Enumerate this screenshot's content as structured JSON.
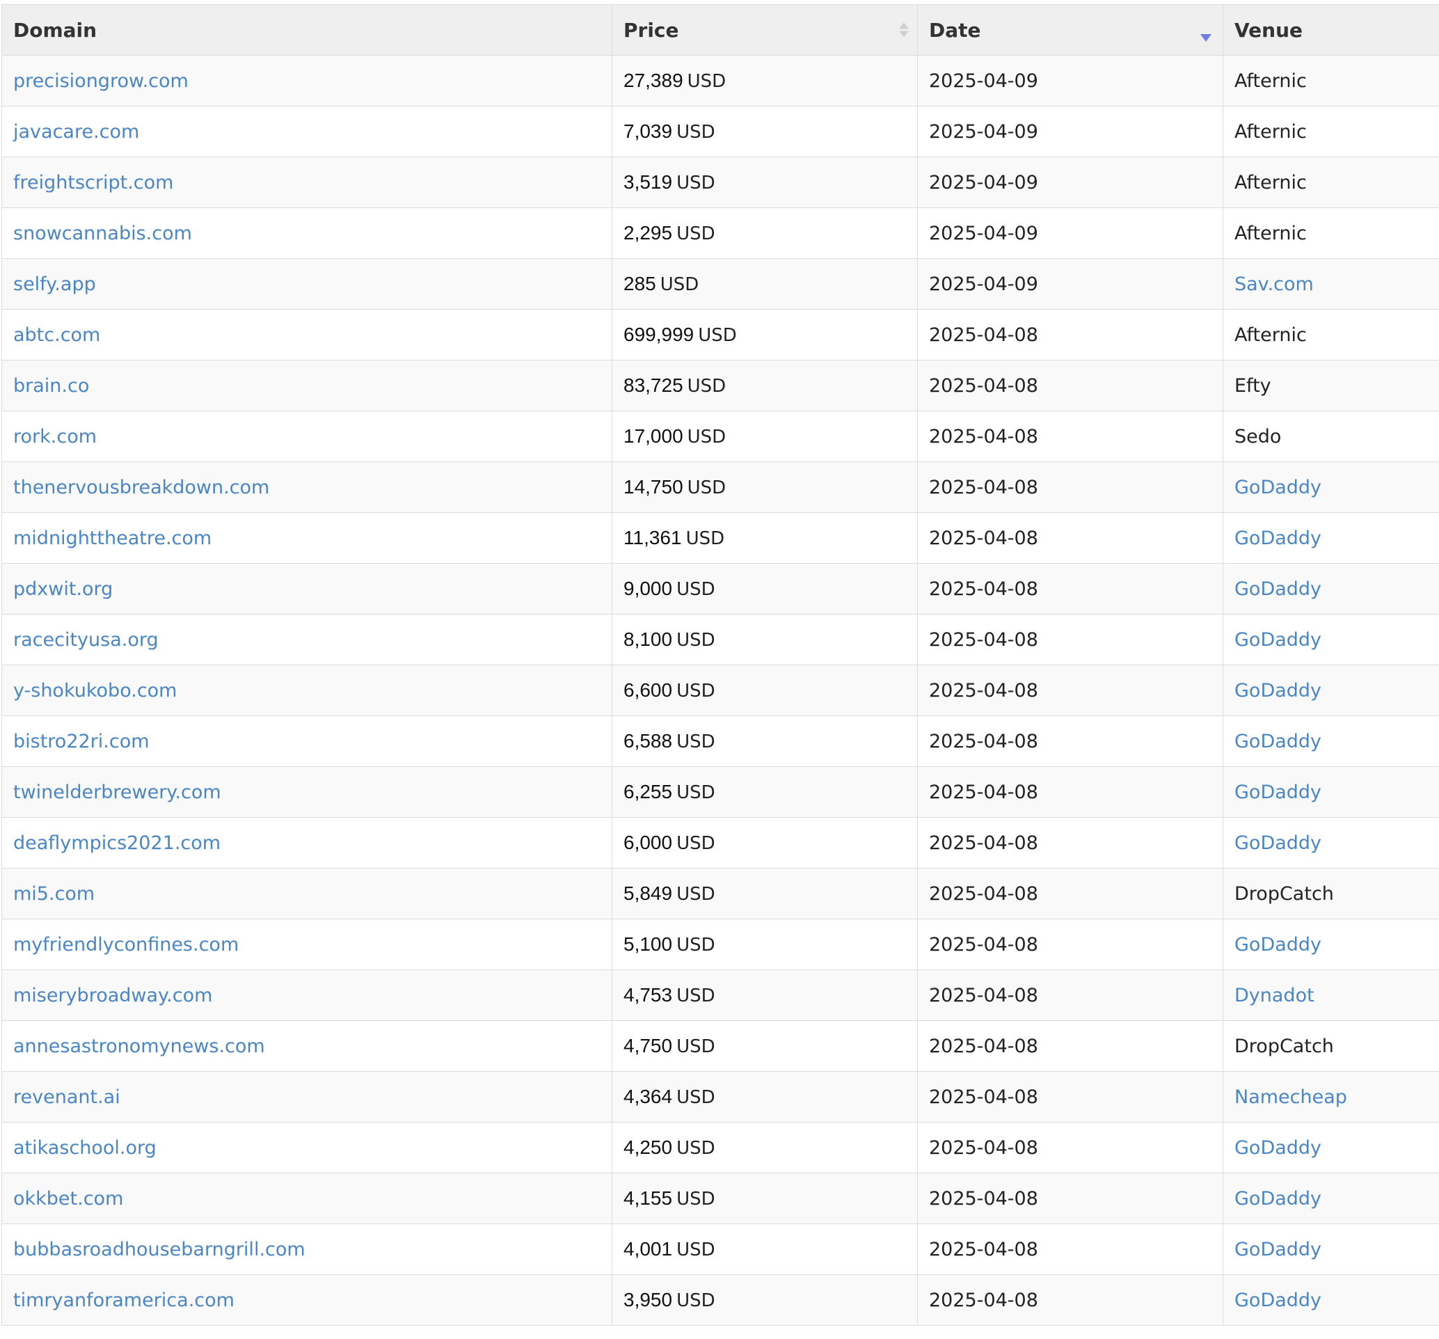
{
  "table": {
    "headers": {
      "domain": "Domain",
      "price": "Price",
      "date": "Date",
      "venue": "Venue"
    },
    "sort": {
      "column": "Date",
      "direction": "descending"
    },
    "link_color": "#4a86c5",
    "rows": [
      {
        "domain": "precisiongrow.com",
        "price": "27,389",
        "currency": "USD",
        "date": "2025-04-09",
        "venue": "Afternic",
        "venue_link": false
      },
      {
        "domain": "javacare.com",
        "price": "7,039",
        "currency": "USD",
        "date": "2025-04-09",
        "venue": "Afternic",
        "venue_link": false
      },
      {
        "domain": "freightscript.com",
        "price": "3,519",
        "currency": "USD",
        "date": "2025-04-09",
        "venue": "Afternic",
        "venue_link": false
      },
      {
        "domain": "snowcannabis.com",
        "price": "2,295",
        "currency": "USD",
        "date": "2025-04-09",
        "venue": "Afternic",
        "venue_link": false
      },
      {
        "domain": "selfy.app",
        "price": "285",
        "currency": "USD",
        "date": "2025-04-09",
        "venue": "Sav.com",
        "venue_link": true
      },
      {
        "domain": "abtc.com",
        "price": "699,999",
        "currency": "USD",
        "date": "2025-04-08",
        "venue": "Afternic",
        "venue_link": false
      },
      {
        "domain": "brain.co",
        "price": "83,725",
        "currency": "USD",
        "date": "2025-04-08",
        "venue": "Efty",
        "venue_link": false
      },
      {
        "domain": "rork.com",
        "price": "17,000",
        "currency": "USD",
        "date": "2025-04-08",
        "venue": "Sedo",
        "venue_link": false
      },
      {
        "domain": "thenervousbreakdown.com",
        "price": "14,750",
        "currency": "USD",
        "date": "2025-04-08",
        "venue": "GoDaddy",
        "venue_link": true
      },
      {
        "domain": "midnighttheatre.com",
        "price": "11,361",
        "currency": "USD",
        "date": "2025-04-08",
        "venue": "GoDaddy",
        "venue_link": true
      },
      {
        "domain": "pdxwit.org",
        "price": "9,000",
        "currency": "USD",
        "date": "2025-04-08",
        "venue": "GoDaddy",
        "venue_link": true
      },
      {
        "domain": "racecityusa.org",
        "price": "8,100",
        "currency": "USD",
        "date": "2025-04-08",
        "venue": "GoDaddy",
        "venue_link": true
      },
      {
        "domain": "y-shokukobo.com",
        "price": "6,600",
        "currency": "USD",
        "date": "2025-04-08",
        "venue": "GoDaddy",
        "venue_link": true
      },
      {
        "domain": "bistro22ri.com",
        "price": "6,588",
        "currency": "USD",
        "date": "2025-04-08",
        "venue": "GoDaddy",
        "venue_link": true
      },
      {
        "domain": "twinelderbrewery.com",
        "price": "6,255",
        "currency": "USD",
        "date": "2025-04-08",
        "venue": "GoDaddy",
        "venue_link": true
      },
      {
        "domain": "deaflympics2021.com",
        "price": "6,000",
        "currency": "USD",
        "date": "2025-04-08",
        "venue": "GoDaddy",
        "venue_link": true
      },
      {
        "domain": "mi5.com",
        "price": "5,849",
        "currency": "USD",
        "date": "2025-04-08",
        "venue": "DropCatch",
        "venue_link": false
      },
      {
        "domain": "myfriendlyconfines.com",
        "price": "5,100",
        "currency": "USD",
        "date": "2025-04-08",
        "venue": "GoDaddy",
        "venue_link": true
      },
      {
        "domain": "miserybroadway.com",
        "price": "4,753",
        "currency": "USD",
        "date": "2025-04-08",
        "venue": "Dynadot",
        "venue_link": true
      },
      {
        "domain": "annesastronomynews.com",
        "price": "4,750",
        "currency": "USD",
        "date": "2025-04-08",
        "venue": "DropCatch",
        "venue_link": false
      },
      {
        "domain": "revenant.ai",
        "price": "4,364",
        "currency": "USD",
        "date": "2025-04-08",
        "venue": "Namecheap",
        "venue_link": true
      },
      {
        "domain": "atikaschool.org",
        "price": "4,250",
        "currency": "USD",
        "date": "2025-04-08",
        "venue": "GoDaddy",
        "venue_link": true
      },
      {
        "domain": "okkbet.com",
        "price": "4,155",
        "currency": "USD",
        "date": "2025-04-08",
        "venue": "GoDaddy",
        "venue_link": true
      },
      {
        "domain": "bubbasroadhousebarngrill.com",
        "price": "4,001",
        "currency": "USD",
        "date": "2025-04-08",
        "venue": "GoDaddy",
        "venue_link": true
      },
      {
        "domain": "timryanforamerica.com",
        "price": "3,950",
        "currency": "USD",
        "date": "2025-04-08",
        "venue": "GoDaddy",
        "venue_link": true
      }
    ]
  }
}
